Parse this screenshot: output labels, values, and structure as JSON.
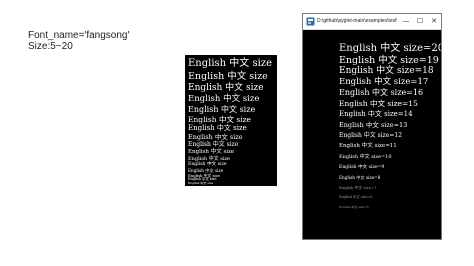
{
  "slide": {
    "font_caption": "Font_name='fangsong'",
    "size_caption": "Size:5~20"
  },
  "left_panel": {
    "lines": [
      "English 中文 size",
      "English 中文 size",
      "English 中文 size",
      "English 中文 size",
      "English 中文 size",
      "English 中文 size",
      "English 中文 size",
      "English 中文 size",
      "English 中文 size",
      "English 中文 size",
      "English 中文 size",
      "English 中文 size",
      "English 中文 size",
      "English 中文 size",
      "English 中文 size",
      "English 中文 size"
    ]
  },
  "window": {
    "title": "D:\\github\\pyglet-main\\examples\\text\\...",
    "minimize_glyph": "—",
    "maximize_glyph": "☐",
    "close_glyph": "✕",
    "lines": [
      "English 中文 size=20",
      "English 中文 size=19",
      "English 中文 size=18",
      "English 中文 size=17",
      "English 中文 size=16",
      "English 中文 size=15",
      "English 中文 size=14",
      "English 中文 size=13",
      "English 中文 size=12",
      "English 中文 size=11",
      "English 中文 size=10",
      "English 中文 size=9",
      "English 中文 size=8",
      "English 中文 size=7",
      "English 中文 size=6",
      "English 中文 size=5"
    ]
  },
  "colors": {
    "panel_background": "#000000",
    "text": "#ffffff",
    "slide_background": "#ffffff",
    "titlebar": "#ffffff"
  },
  "icons": {
    "app_icon": "pyglet-app-icon"
  }
}
